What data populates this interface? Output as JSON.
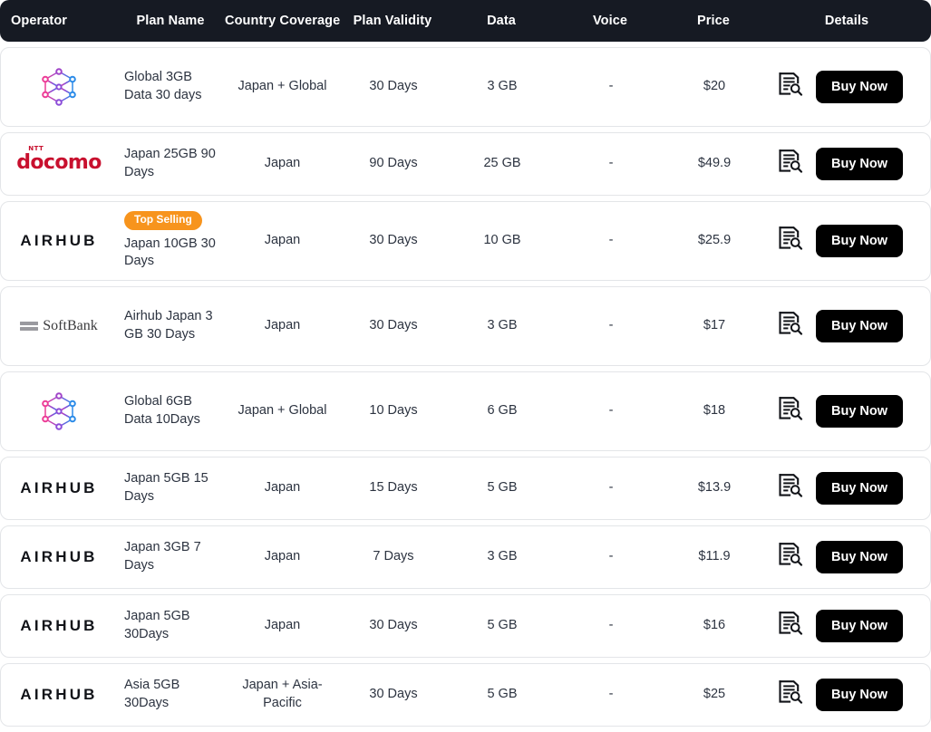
{
  "table": {
    "columns": [
      {
        "key": "operator",
        "label": "Operator"
      },
      {
        "key": "plan_name",
        "label": "Plan Name"
      },
      {
        "key": "coverage",
        "label": "Country Coverage"
      },
      {
        "key": "validity",
        "label": "Plan Validity"
      },
      {
        "key": "data",
        "label": "Data"
      },
      {
        "key": "voice",
        "label": "Voice"
      },
      {
        "key": "price",
        "label": "Price"
      },
      {
        "key": "details",
        "label": "Details"
      }
    ],
    "details_icon": "document-search-icon",
    "buy_label": "Buy Now",
    "badge_color": "#F7941D",
    "header_bg": "#161A23",
    "rows": [
      {
        "operator_logo": "mesh-network-logo",
        "operator_name": "",
        "badge": "",
        "plan_name": "Global 3GB Data 30 days",
        "coverage": "Japan + Global",
        "validity": "30 Days",
        "data": "3 GB",
        "voice": "-",
        "price": "$20",
        "buy_label": "Buy Now"
      },
      {
        "operator_logo": "docomo-logo",
        "operator_name": "docomo",
        "operator_sup": "NTT",
        "badge": "",
        "plan_name": "Japan 25GB 90 Days",
        "coverage": "Japan",
        "validity": "90 Days",
        "data": "25 GB",
        "voice": "-",
        "price": "$49.9",
        "buy_label": "Buy Now"
      },
      {
        "operator_logo": "airhub-logo",
        "operator_name": "AIRHUB",
        "badge": "Top Selling",
        "plan_name": "Japan 10GB 30 Days",
        "coverage": "Japan",
        "validity": "30 Days",
        "data": "10 GB",
        "voice": "-",
        "price": "$25.9",
        "buy_label": "Buy Now"
      },
      {
        "operator_logo": "softbank-logo",
        "operator_name": "SoftBank",
        "badge": "",
        "plan_name": "Airhub Japan 3 GB 30 Days",
        "coverage": "Japan",
        "validity": "30 Days",
        "data": "3 GB",
        "voice": "-",
        "price": "$17",
        "buy_label": "Buy Now"
      },
      {
        "operator_logo": "mesh-network-logo",
        "operator_name": "",
        "badge": "",
        "plan_name": "Global 6GB Data 10Days",
        "coverage": "Japan + Global",
        "validity": "10 Days",
        "data": "6 GB",
        "voice": "-",
        "price": "$18",
        "buy_label": "Buy Now"
      },
      {
        "operator_logo": "airhub-logo",
        "operator_name": "AIRHUB",
        "badge": "",
        "plan_name": "Japan 5GB 15 Days",
        "coverage": "Japan",
        "validity": "15 Days",
        "data": "5 GB",
        "voice": "-",
        "price": "$13.9",
        "buy_label": "Buy Now"
      },
      {
        "operator_logo": "airhub-logo",
        "operator_name": "AIRHUB",
        "badge": "",
        "plan_name": "Japan 3GB 7 Days",
        "coverage": "Japan",
        "validity": "7 Days",
        "data": "3 GB",
        "voice": "-",
        "price": "$11.9",
        "buy_label": "Buy Now"
      },
      {
        "operator_logo": "airhub-logo",
        "operator_name": "AIRHUB",
        "badge": "",
        "plan_name": "Japan 5GB 30Days",
        "coverage": "Japan",
        "validity": "30 Days",
        "data": "5 GB",
        "voice": "-",
        "price": "$16",
        "buy_label": "Buy Now"
      },
      {
        "operator_logo": "airhub-logo",
        "operator_name": "AIRHUB",
        "badge": "",
        "plan_name": "Asia 5GB 30Days",
        "coverage": "Japan + Asia-Pacific",
        "validity": "30 Days",
        "data": "5 GB",
        "voice": "-",
        "price": "$25",
        "buy_label": "Buy Now"
      }
    ]
  }
}
